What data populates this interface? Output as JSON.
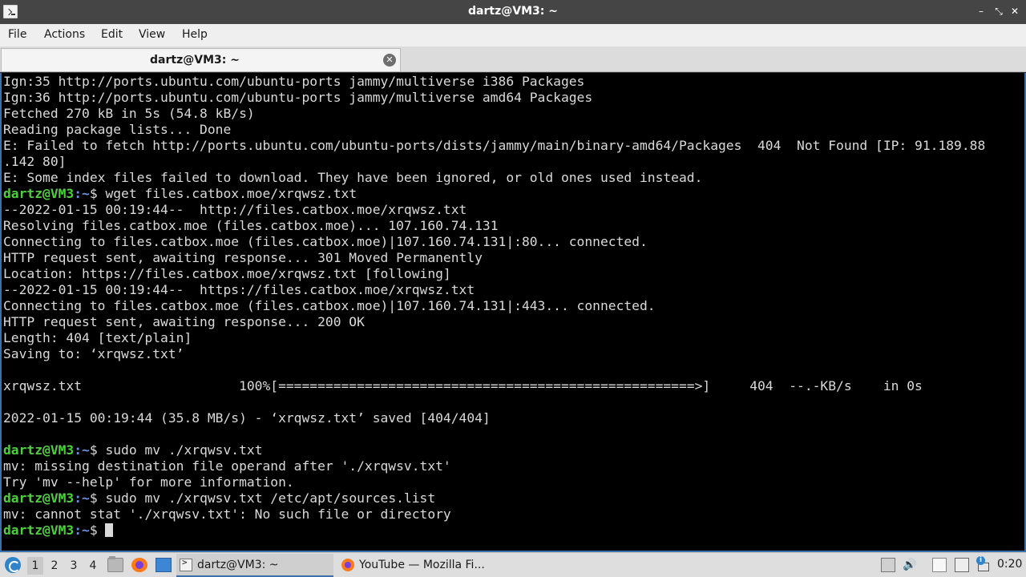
{
  "window": {
    "title": "dartz@VM3: ~",
    "controls": {
      "minimize": "–",
      "restore": "⤡",
      "close": "✕"
    }
  },
  "menu": [
    "File",
    "Actions",
    "Edit",
    "View",
    "Help"
  ],
  "tab": {
    "label": "dartz@VM3: ~",
    "close": "✕"
  },
  "terminal": {
    "prompt_user": "dartz@VM3",
    "prompt_path": ":~",
    "lines": [
      {
        "text": "Ign:35 http://ports.ubuntu.com/ubuntu-ports jammy/multiverse i386 Packages"
      },
      {
        "text": "Ign:36 http://ports.ubuntu.com/ubuntu-ports jammy/multiverse amd64 Packages"
      },
      {
        "text": "Fetched 270 kB in 5s (54.8 kB/s)"
      },
      {
        "text": "Reading package lists... Done"
      },
      {
        "text": "E: Failed to fetch http://ports.ubuntu.com/ubuntu-ports/dists/jammy/main/binary-amd64/Packages  404  Not Found [IP: 91.189.88"
      },
      {
        "text": ".142 80]"
      },
      {
        "text": "E: Some index files failed to download. They have been ignored, or old ones used instead."
      },
      {
        "prompt": true,
        "text": "$ wget files.catbox.moe/xrqwsz.txt"
      },
      {
        "text": "--2022-01-15 00:19:44--  http://files.catbox.moe/xrqwsz.txt"
      },
      {
        "text": "Resolving files.catbox.moe (files.catbox.moe)... 107.160.74.131"
      },
      {
        "text": "Connecting to files.catbox.moe (files.catbox.moe)|107.160.74.131|:80... connected."
      },
      {
        "text": "HTTP request sent, awaiting response... 301 Moved Permanently"
      },
      {
        "text": "Location: https://files.catbox.moe/xrqwsz.txt [following]"
      },
      {
        "text": "--2022-01-15 00:19:44--  https://files.catbox.moe/xrqwsz.txt"
      },
      {
        "text": "Connecting to files.catbox.moe (files.catbox.moe)|107.160.74.131|:443... connected."
      },
      {
        "text": "HTTP request sent, awaiting response... 200 OK"
      },
      {
        "text": "Length: 404 [text/plain]"
      },
      {
        "text": "Saving to: ‘xrqwsz.txt’"
      },
      {
        "text": ""
      },
      {
        "text": "xrqwsz.txt                    100%[=====================================================>]     404  --.-KB/s    in 0s"
      },
      {
        "text": ""
      },
      {
        "text": "2022-01-15 00:19:44 (35.8 MB/s) - ‘xrqwsz.txt’ saved [404/404]"
      },
      {
        "text": ""
      },
      {
        "prompt": true,
        "text": "$ sudo mv ./xrqwsv.txt"
      },
      {
        "text": "mv: missing destination file operand after './xrqwsv.txt'"
      },
      {
        "text": "Try 'mv --help' for more information."
      },
      {
        "prompt": true,
        "text": "$ sudo mv ./xrqwsv.txt /etc/apt/sources.list"
      },
      {
        "text": "mv: cannot stat './xrqwsv.txt': No such file or directory"
      },
      {
        "prompt": true,
        "text": "$ ",
        "cursor": true
      }
    ]
  },
  "taskbar": {
    "workspaces": [
      "1",
      "2",
      "3",
      "4"
    ],
    "active_workspace": "1",
    "tasks": {
      "terminal": "dartz@VM3: ~",
      "firefox": "YouTube — Mozilla Fi..."
    },
    "tray": {
      "volume_icon": "🔊",
      "info_badge": "i"
    },
    "clock": "0:20"
  },
  "colors": {
    "terminal_bg": "#000000",
    "prompt_user": "#4fcf3f",
    "prompt_path": "#6f8fe0",
    "accent": "#3f6fa8"
  }
}
